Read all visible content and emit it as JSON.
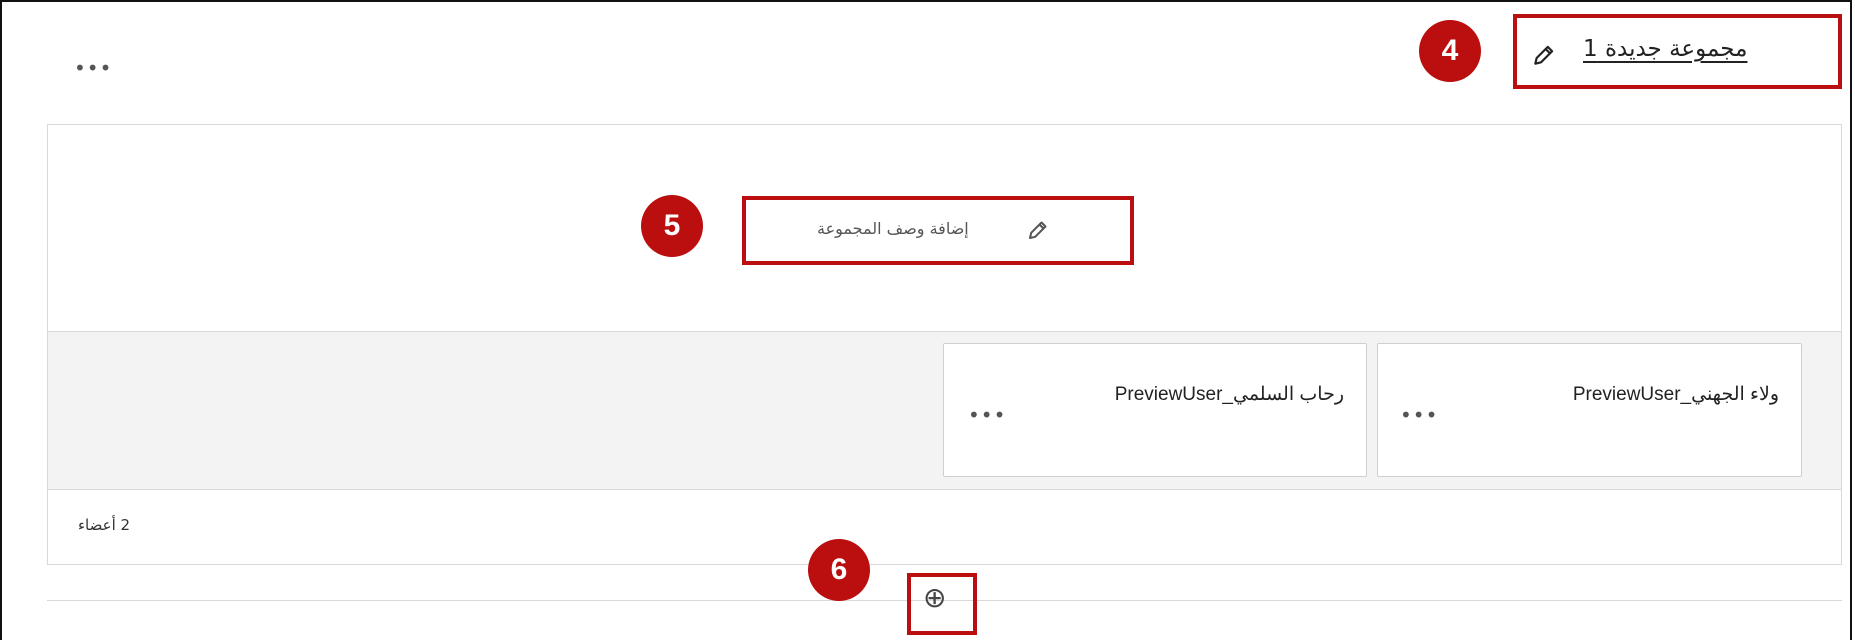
{
  "group": {
    "title": "مجموعة جديدة 1",
    "more_label": "•••",
    "description_label": "إضافة وصف المجموعة",
    "member_count": "2 أعضاء"
  },
  "members": [
    {
      "name": "ولاء الجهني_PreviewUser",
      "more_label": "•••"
    },
    {
      "name": "رحاب السلمي_PreviewUser",
      "more_label": "•••"
    }
  ],
  "add_button": {
    "glyph": "⊕"
  },
  "callouts": [
    "4",
    "5",
    "6"
  ],
  "colors": {
    "callout": "#bb0f0f",
    "border": "#d9d9d9",
    "strip": "#f3f3f3"
  },
  "icons": [
    "pencil-icon",
    "more-icon",
    "add-circle-icon"
  ]
}
